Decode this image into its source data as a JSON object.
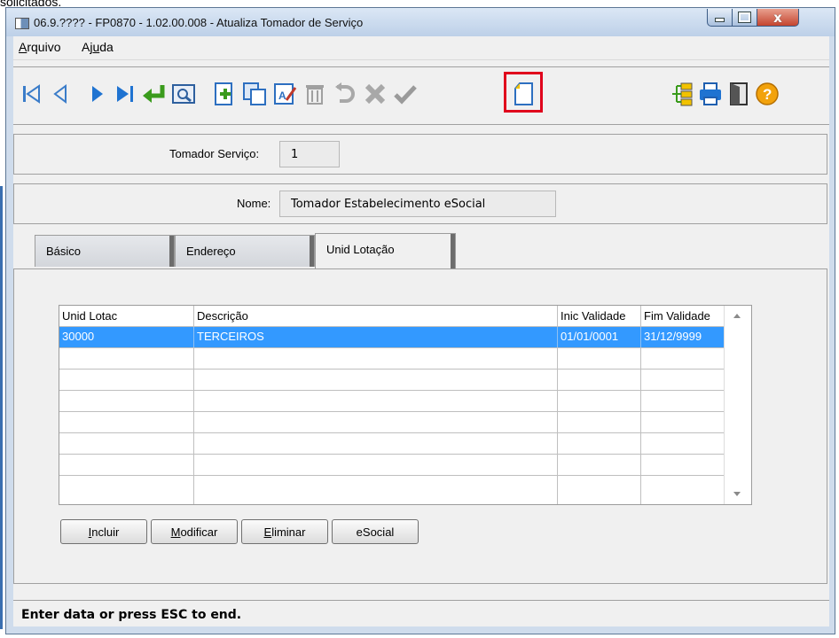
{
  "caption_above": "solicitados.",
  "window": {
    "title": "06.9.???? - FP0870 - 1.02.00.008 - Atualiza Tomador de Serviço",
    "close_glyph": "x"
  },
  "menu": {
    "arquivo_accel": "A",
    "arquivo_rest": "rquivo",
    "ajuda_pre": "Aj",
    "ajuda_accel": "u",
    "ajuda_post": "da"
  },
  "toolbar": {
    "icons": [
      "first-record-icon",
      "previous-record-icon",
      "next-record-icon",
      "last-record-icon",
      "go-to-icon",
      "search-icon",
      "add-icon",
      "copy-icon",
      "edit-icon",
      "delete-icon",
      "undo-icon",
      "cancel-icon",
      "save-icon",
      "new-document-icon",
      "structure-icon",
      "print-icon",
      "exit-icon",
      "help-icon"
    ],
    "highlight_color": "#e0001c"
  },
  "fields": {
    "tomador_label": "Tomador Serviço:",
    "tomador_value": "1",
    "nome_label": "Nome:",
    "nome_value": "Tomador Estabelecimento eSocial"
  },
  "tabs": [
    "Básico",
    "Endereço",
    "Unid Lotação"
  ],
  "active_tab": "Unid Lotação",
  "grid": {
    "columns": [
      "Unid Lotac",
      "Descrição",
      "Inic Validade",
      "Fim Validade"
    ],
    "rows": [
      [
        "30000",
        "TERCEIROS",
        "01/01/0001",
        "31/12/9999"
      ]
    ],
    "selected_row": 0,
    "selection_color": "#3399ff"
  },
  "buttons": {
    "incluir_accel": "I",
    "incluir_rest": "ncluir",
    "modificar_accel": "M",
    "modificar_rest": "odificar",
    "eliminar_accel": "E",
    "eliminar_rest": "liminar",
    "esocial": "eSocial"
  },
  "status_text": "Enter data or press ESC to end."
}
